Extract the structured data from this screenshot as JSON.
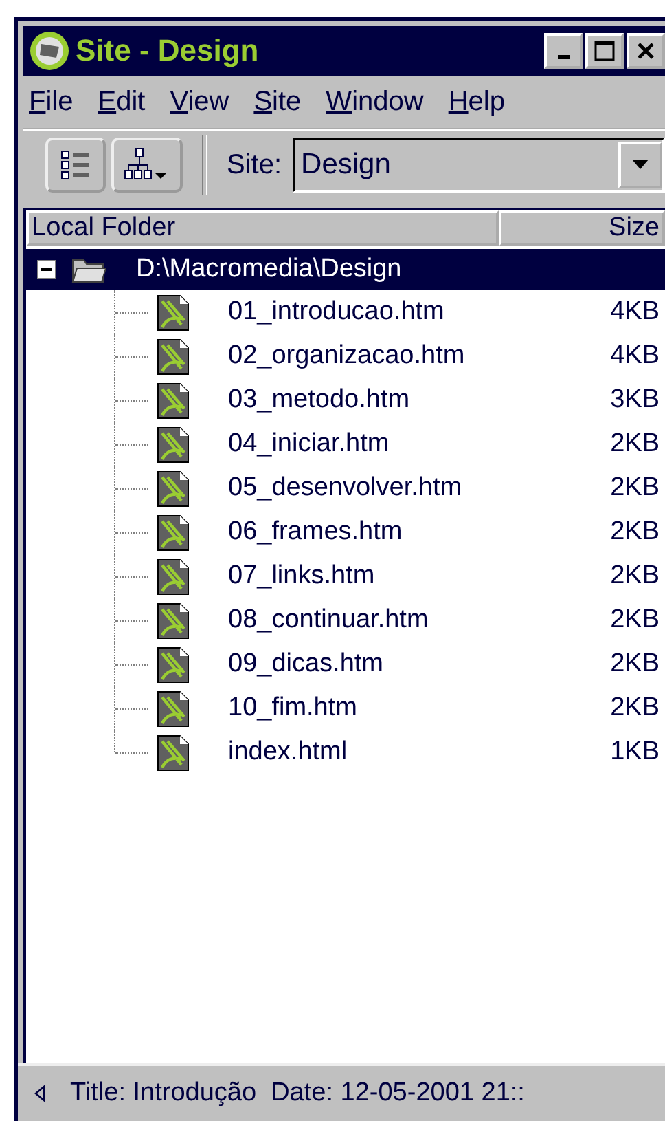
{
  "window": {
    "title": "Site - Design"
  },
  "menu": [
    {
      "mnemonic": "F",
      "rest": "ile"
    },
    {
      "mnemonic": "E",
      "rest": "dit"
    },
    {
      "mnemonic": "V",
      "rest": "iew"
    },
    {
      "mnemonic": "S",
      "rest": "ite"
    },
    {
      "mnemonic": "W",
      "rest": "indow"
    },
    {
      "mnemonic": "H",
      "rest": "elp"
    }
  ],
  "toolbar": {
    "site_label": "Site:",
    "site_value": "Design"
  },
  "columns": [
    "Local Folder",
    "Size"
  ],
  "tree": {
    "label": "D:\\Macromedia\\Design",
    "selected": true,
    "expanded": true,
    "children": [
      {
        "name": "01_introducao.htm",
        "size": "4KB"
      },
      {
        "name": "02_organizacao.htm",
        "size": "4KB"
      },
      {
        "name": "03_metodo.htm",
        "size": "3KB"
      },
      {
        "name": "04_iniciar.htm",
        "size": "2KB"
      },
      {
        "name": "05_desenvolver.htm",
        "size": "2KB"
      },
      {
        "name": "06_frames.htm",
        "size": "2KB"
      },
      {
        "name": "07_links.htm",
        "size": "2KB"
      },
      {
        "name": "08_continuar.htm",
        "size": "2KB"
      },
      {
        "name": "09_dicas.htm",
        "size": "2KB"
      },
      {
        "name": "10_fim.htm",
        "size": "2KB"
      },
      {
        "name": "index.html",
        "size": "1KB"
      }
    ]
  },
  "status_bar": {
    "text": "Title: Introdução  Date: 12-05-2001 21::"
  }
}
